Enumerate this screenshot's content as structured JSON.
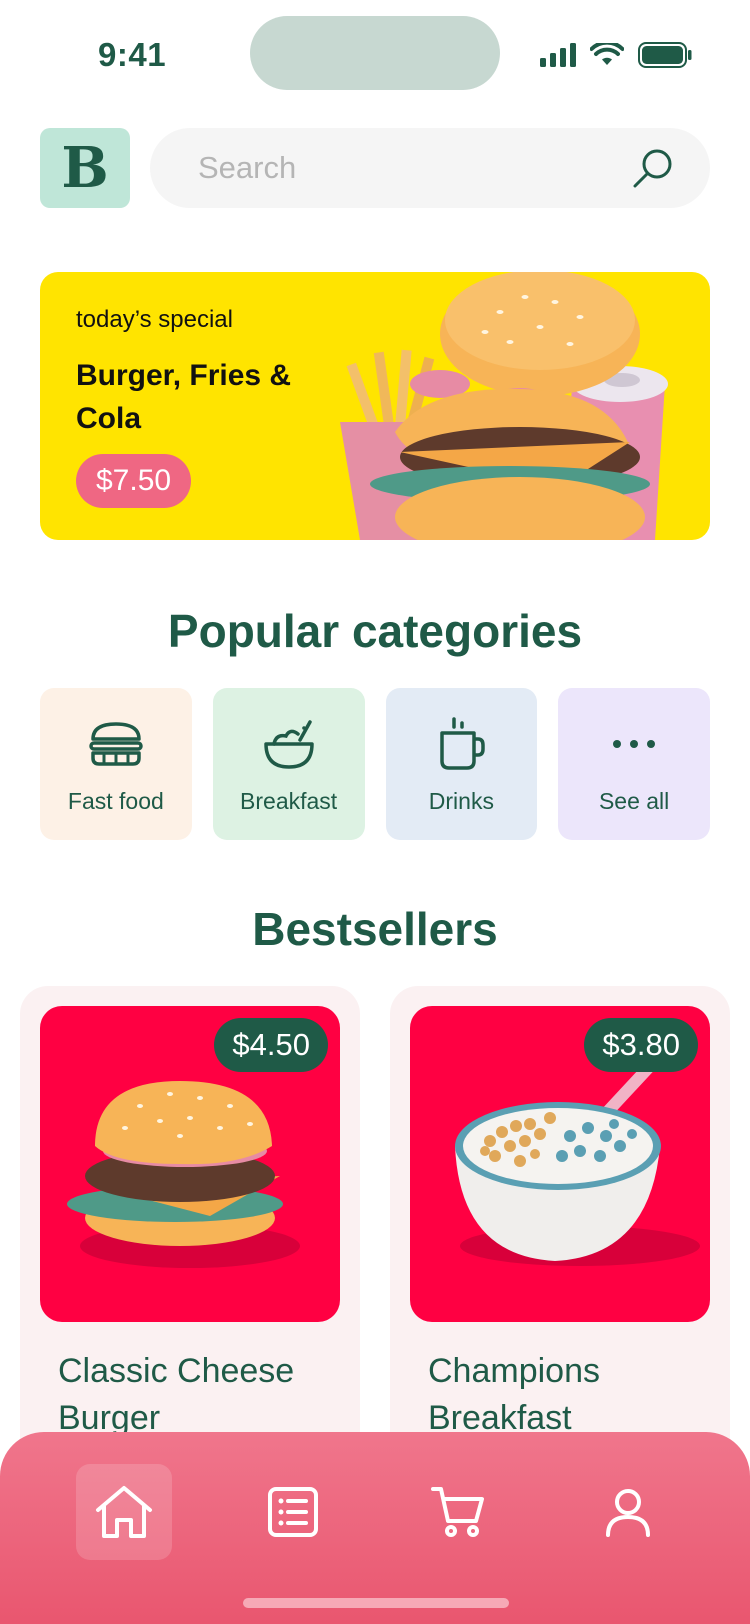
{
  "status_bar": {
    "time": "9:41"
  },
  "header": {
    "logo_letter": "B",
    "search": {
      "placeholder": "Search",
      "value": ""
    }
  },
  "special": {
    "eyebrow": "today’s special",
    "title": "Burger, Fries & Cola",
    "price": "$7.50"
  },
  "categories": {
    "heading": "Popular categories",
    "items": [
      {
        "label": "Fast food",
        "icon": "burger-icon",
        "color": "#fdf1e6"
      },
      {
        "label": "Breakfast",
        "icon": "bowl-icon",
        "color": "#ddf2e3"
      },
      {
        "label": "Drinks",
        "icon": "mug-icon",
        "color": "#e3ebf5"
      },
      {
        "label": "See all",
        "icon": "more-dots-icon",
        "color": "#ece6fb"
      }
    ]
  },
  "bestsellers": {
    "heading": "Bestsellers",
    "items": [
      {
        "name": "Classic Cheese Burger",
        "price": "$4.50"
      },
      {
        "name": "Champions Breakfast",
        "price": "$3.80"
      }
    ]
  },
  "bottom_nav": {
    "items": [
      "home-icon",
      "menu-list-icon",
      "cart-icon",
      "profile-icon"
    ],
    "active": "home-icon"
  },
  "colors": {
    "primary": "#1f5a47",
    "banner": "#ffe400",
    "accent_pink": "#ef6783",
    "product_bg": "#ff0042"
  }
}
